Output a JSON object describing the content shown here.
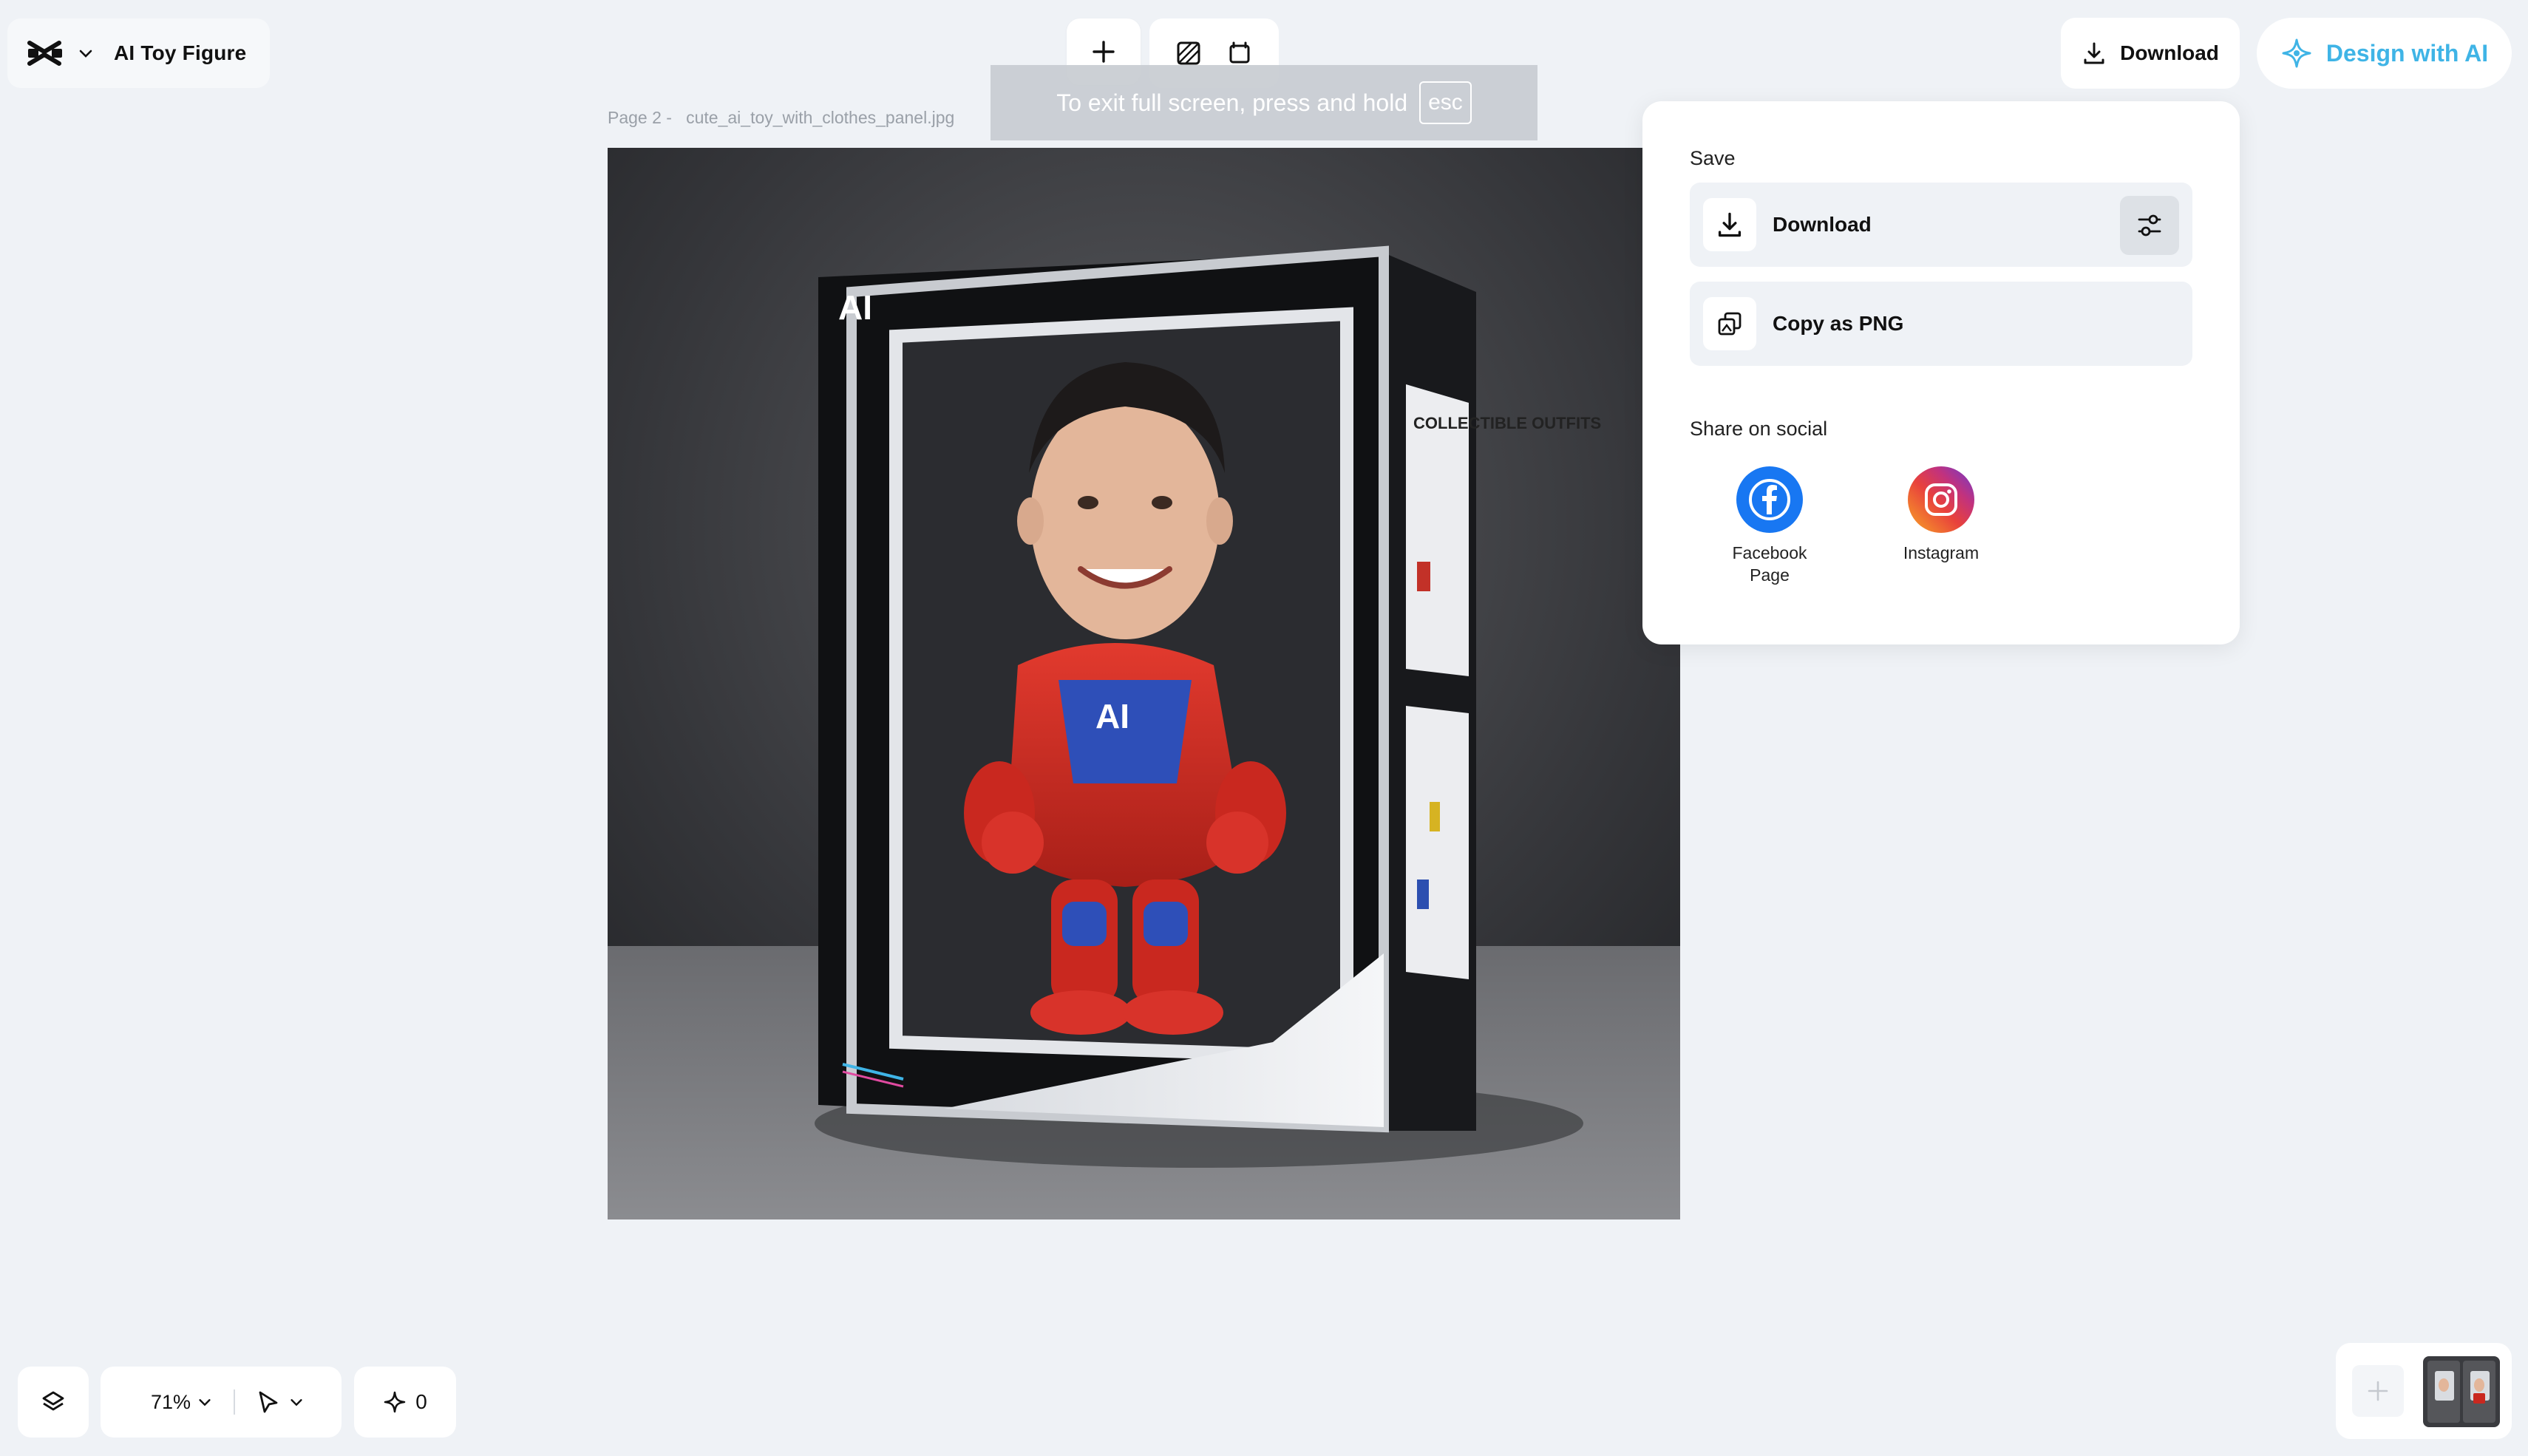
{
  "header": {
    "project_title": "AI Toy Figure",
    "download_label": "Download",
    "design_ai_label": "Design with AI"
  },
  "toast": {
    "message": "To exit full screen, press and hold",
    "key": "esc"
  },
  "canvas": {
    "page_label": "Page 2 -",
    "file_name": "cute_ai_toy_with_clothes_panel.jpg",
    "box_logo": "AI",
    "box_side_title": "COLLECTIBLE OUTFITS",
    "chest_logo": "AI"
  },
  "panel": {
    "save_title": "Save",
    "download_label": "Download",
    "copy_label": "Copy as PNG",
    "share_title": "Share on social",
    "social": [
      {
        "label_line1": "Facebook",
        "label_line2": "Page"
      },
      {
        "label_line1": "Instagram",
        "label_line2": ""
      }
    ]
  },
  "footer": {
    "zoom": "71%",
    "credits": "0"
  },
  "colors": {
    "background": "#eff2f6",
    "accent_ai": "#3fb4e6",
    "facebook": "#1877f2"
  }
}
